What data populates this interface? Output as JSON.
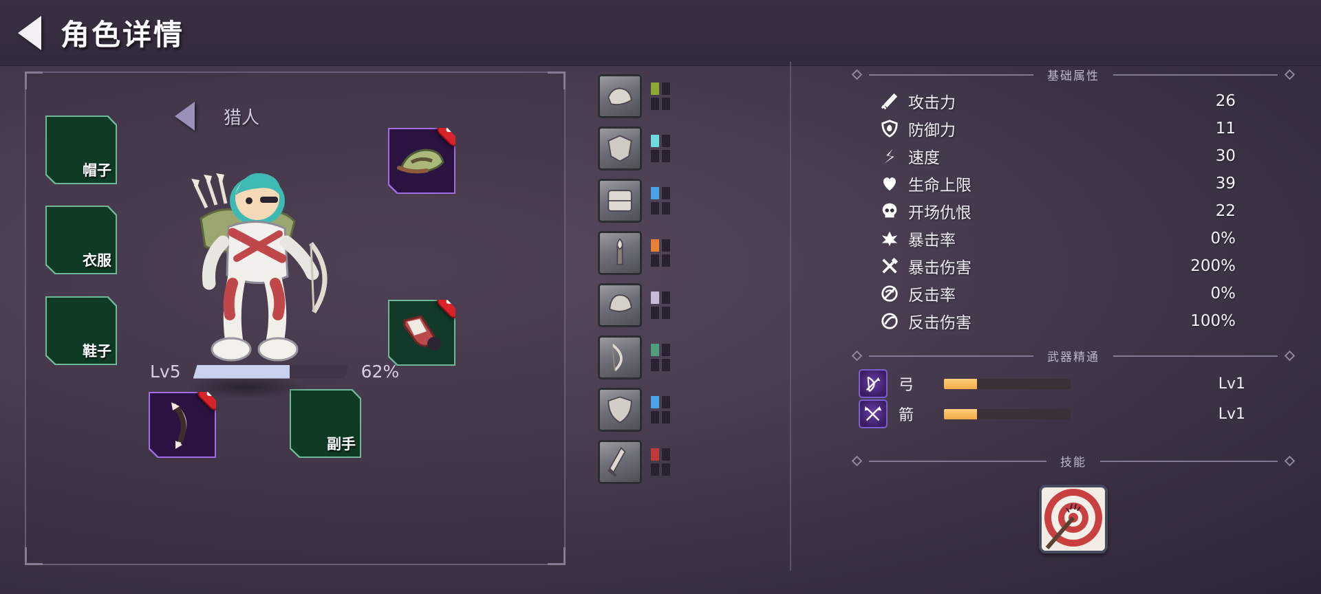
{
  "header": {
    "back_icon": "back-arrow-icon",
    "title": "角色详情"
  },
  "character": {
    "class_name": "猎人",
    "prev_icon": "chevron-left-icon",
    "level_label": "Lv5",
    "xp_percent_label": "62%",
    "xp_percent": 62,
    "equipment_slots": [
      {
        "id": "hat",
        "label": "帽子",
        "state": "empty"
      },
      {
        "id": "clothes",
        "label": "衣服",
        "state": "empty"
      },
      {
        "id": "shoes",
        "label": "鞋子",
        "state": "empty"
      },
      {
        "id": "offhand",
        "label": "副手",
        "state": "empty"
      }
    ],
    "equipped": [
      {
        "id": "equipped-hat",
        "rarity": "purple",
        "icon": "hunter-cap-icon",
        "remove_icon": "remove-badge-icon"
      },
      {
        "id": "equipped-boots",
        "rarity": "green",
        "icon": "boot-icon",
        "remove_icon": "remove-badge-icon"
      },
      {
        "id": "equipped-weapon",
        "rarity": "purple",
        "icon": "bow-icon",
        "remove_icon": "remove-badge-icon"
      }
    ]
  },
  "inventory": {
    "items": [
      {
        "icon": "shoe-item-icon",
        "rarity_color": "#8fa832"
      },
      {
        "icon": "armor-item-icon",
        "rarity_color": "#6fd8e0"
      },
      {
        "icon": "cloth-item-icon",
        "rarity_color": "#4aa3e8"
      },
      {
        "icon": "torch-item-icon",
        "rarity_color": "#e8803a"
      },
      {
        "icon": "helm-item-icon",
        "rarity_color": "#c9bcd6"
      },
      {
        "icon": "bow-item-icon",
        "rarity_color": "#4f9e7c"
      },
      {
        "icon": "shield-item-icon",
        "rarity_color": "#4aa3e8"
      },
      {
        "icon": "sword-item-icon",
        "rarity_color": "#c03a3a"
      }
    ]
  },
  "stats": {
    "section_title": "基础属性",
    "rows": [
      {
        "icon": "sword-icon",
        "label": "攻击力",
        "value": "26"
      },
      {
        "icon": "shield-icon",
        "label": "防御力",
        "value": "11"
      },
      {
        "icon": "boot-speed-icon",
        "label": "速度",
        "value": "30"
      },
      {
        "icon": "heart-icon",
        "label": "生命上限",
        "value": "39"
      },
      {
        "icon": "skull-icon",
        "label": "开场仇恨",
        "value": "22"
      },
      {
        "icon": "crit-rate-icon",
        "label": "暴击率",
        "value": "0%"
      },
      {
        "icon": "crit-dmg-icon",
        "label": "暴击伤害",
        "value": "200%"
      },
      {
        "icon": "counter-rate-icon",
        "label": "反击率",
        "value": "0%"
      },
      {
        "icon": "counter-dmg-icon",
        "label": "反击伤害",
        "value": "100%"
      }
    ]
  },
  "mastery": {
    "section_title": "武器精通",
    "rows": [
      {
        "icon": "bow-mastery-icon",
        "name": "弓",
        "level": "Lv1",
        "progress": 26
      },
      {
        "icon": "arrow-mastery-icon",
        "name": "箭",
        "level": "Lv1",
        "progress": 26
      }
    ]
  },
  "skills": {
    "section_title": "技能",
    "items": [
      {
        "icon": "bullseye-target-icon"
      }
    ]
  }
}
